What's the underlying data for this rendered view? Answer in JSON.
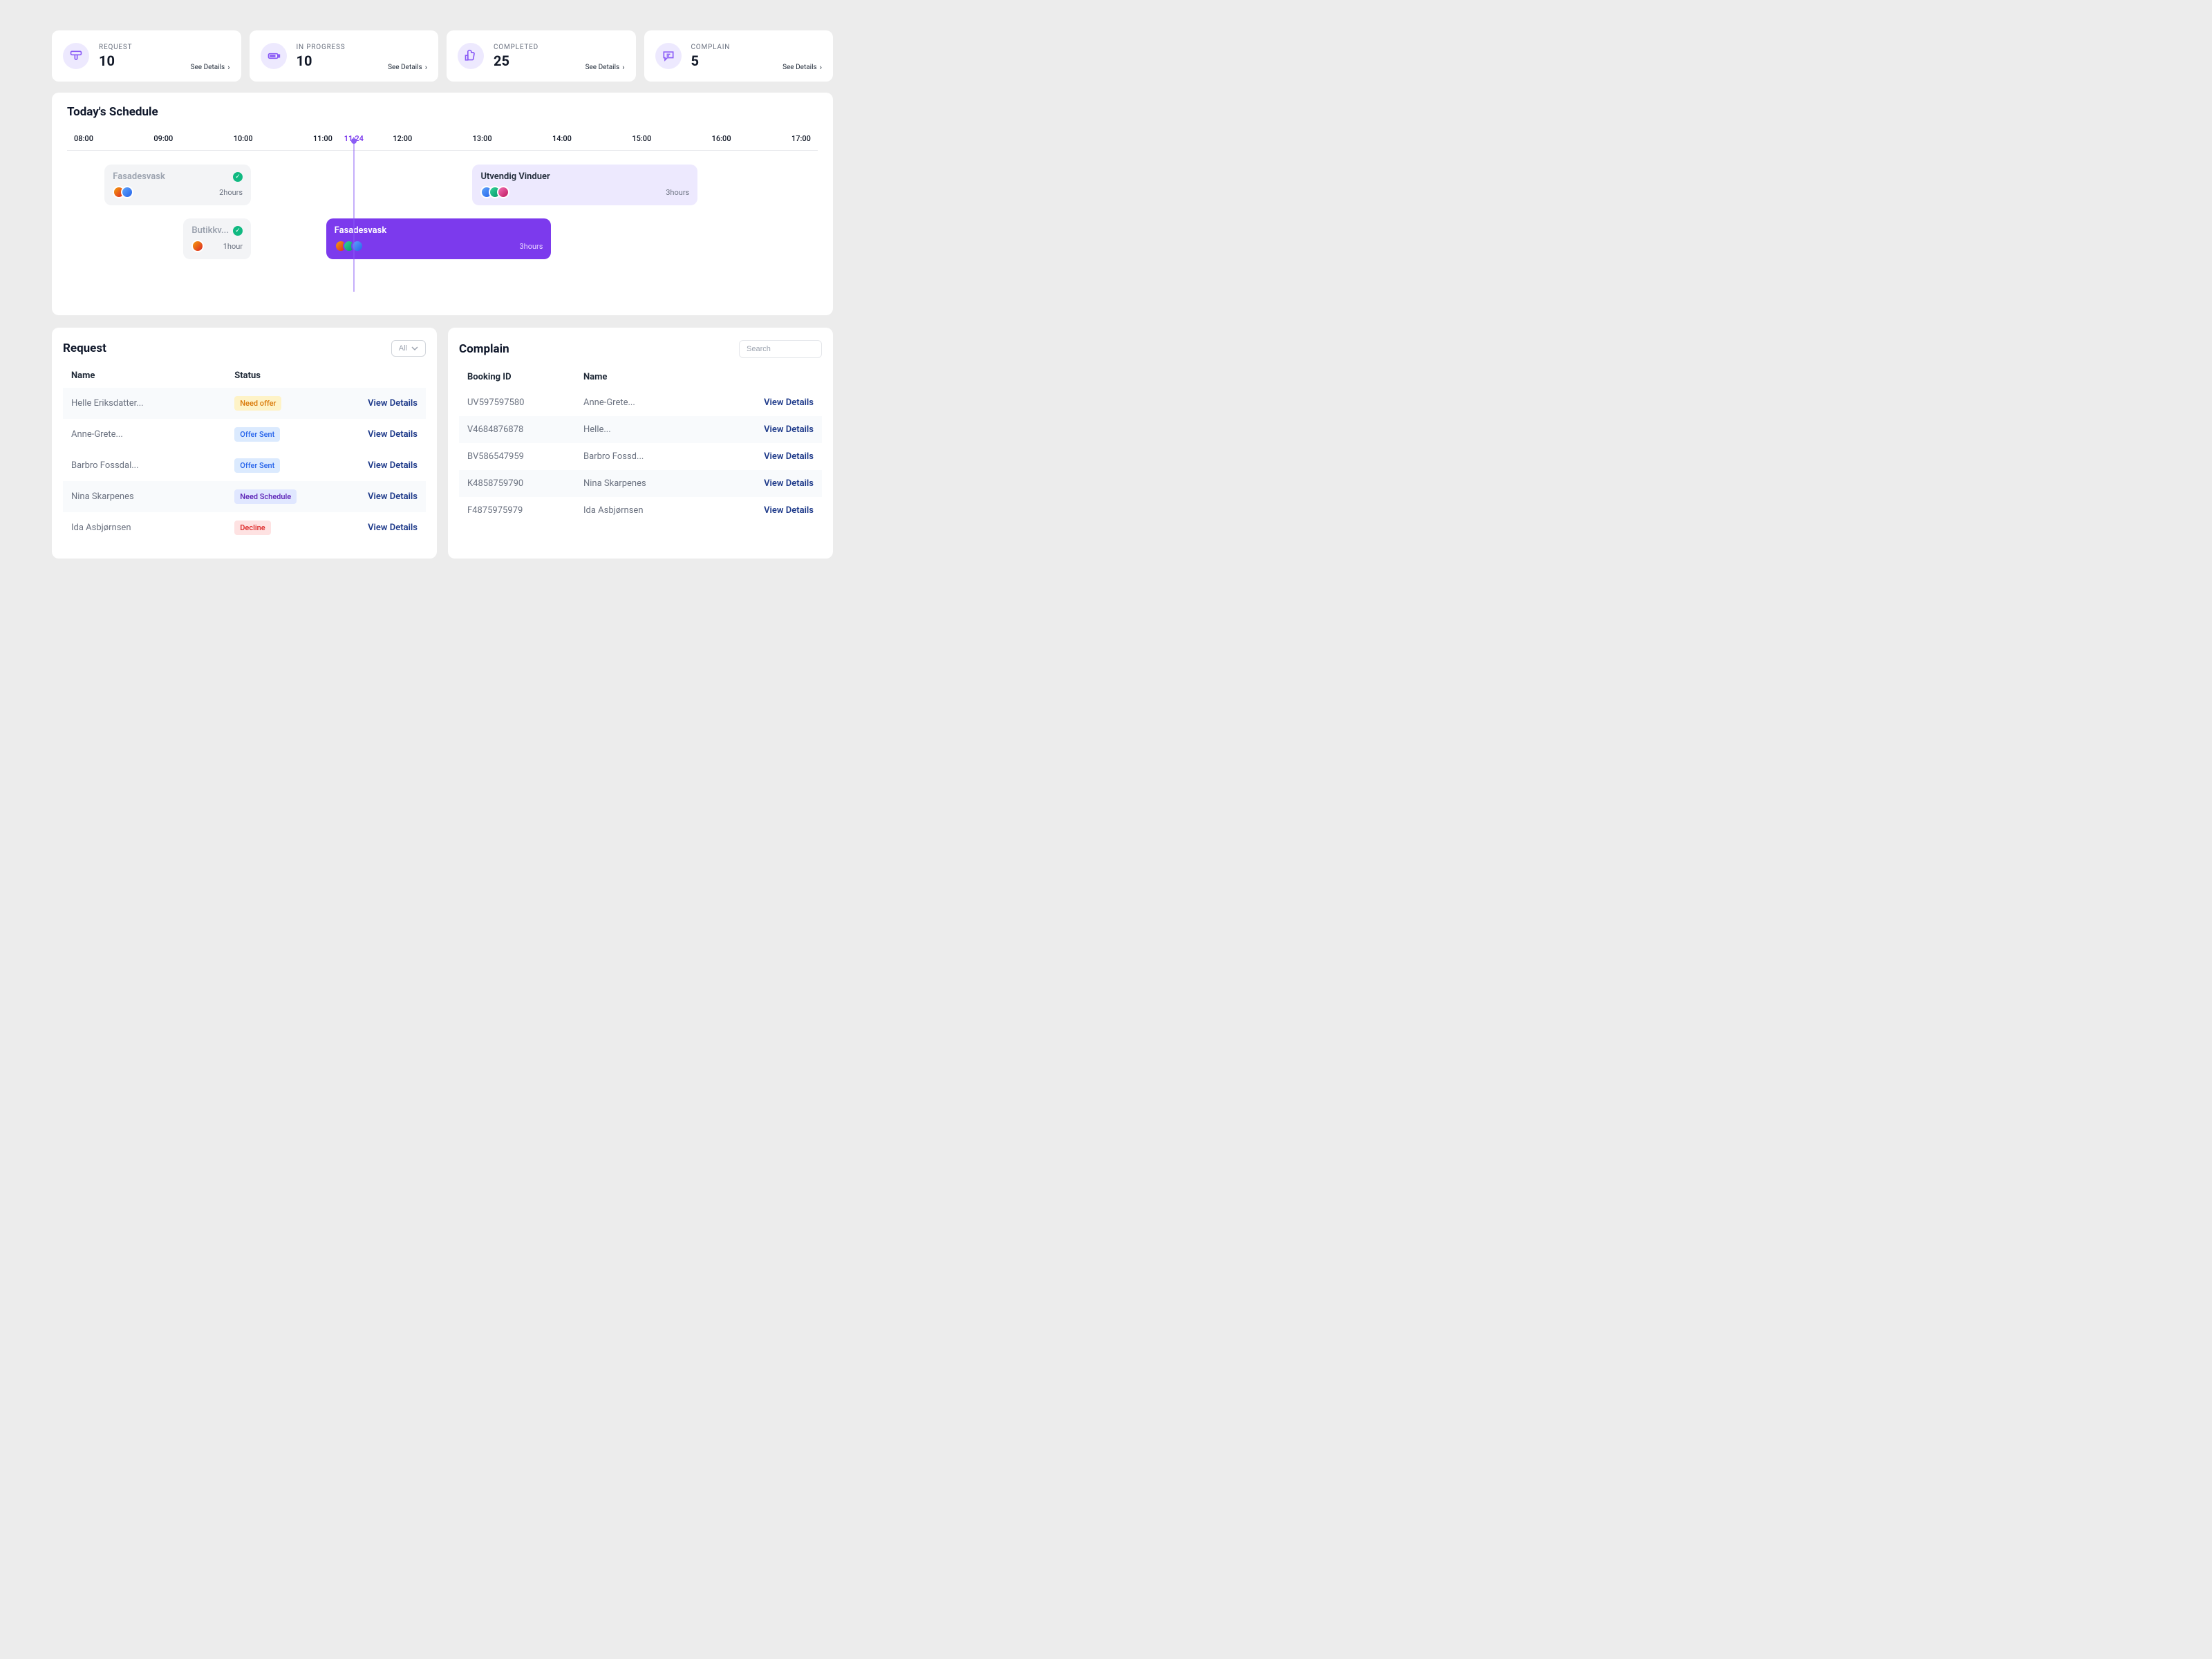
{
  "cards": [
    {
      "label": "REQUEST",
      "value": "10",
      "details": "See Details"
    },
    {
      "label": "IN PROGRESS",
      "value": "10",
      "details": "See Details"
    },
    {
      "label": "COMPLETED",
      "value": "25",
      "details": "See Details"
    },
    {
      "label": "COMPLAIN",
      "value": "5",
      "details": "See Details"
    }
  ],
  "schedule": {
    "title": "Today's Schedule",
    "hours": [
      "08:00",
      "09:00",
      "10:00",
      "11:00",
      "12:00",
      "13:00",
      "14:00",
      "15:00",
      "16:00",
      "17:00"
    ],
    "current_time": "11:24",
    "events": [
      {
        "title": "Fasadesvask",
        "duration": "2hours",
        "checked": true
      },
      {
        "title": "Butikkv...",
        "duration": "1hour",
        "checked": true
      },
      {
        "title": "Utvendig Vinduer",
        "duration": "3hours",
        "checked": false
      },
      {
        "title": "Fasadesvask",
        "duration": "3hours",
        "checked": false
      }
    ]
  },
  "request": {
    "title": "Request",
    "filter_label": "All",
    "columns": {
      "name": "Name",
      "status": "Status"
    },
    "view_label": "View Details",
    "rows": [
      {
        "name": "Helle Eriksdatter...",
        "status": "Need offer",
        "status_class": "need-offer",
        "zebra": true
      },
      {
        "name": "Anne-Grete...",
        "status": "Offer Sent",
        "status_class": "offer-sent",
        "zebra": false
      },
      {
        "name": "Barbro Fossdal...",
        "status": "Offer Sent",
        "status_class": "offer-sent",
        "zebra": false
      },
      {
        "name": "Nina Skarpenes",
        "status": "Need Schedule",
        "status_class": "need-schedule",
        "zebra": true
      },
      {
        "name": "Ida Asbjørnsen",
        "status": "Decline",
        "status_class": "decline",
        "zebra": false
      }
    ]
  },
  "complain": {
    "title": "Complain",
    "search_placeholder": "Search",
    "columns": {
      "booking": "Booking ID",
      "name": "Name"
    },
    "view_label": "View Details",
    "rows": [
      {
        "booking": "UV597597580",
        "name": "Anne-Grete...",
        "zebra": false
      },
      {
        "booking": "V4684876878",
        "name": "Helle...",
        "zebra": true
      },
      {
        "booking": "BV586547959",
        "name": "Barbro Fossd...",
        "zebra": false
      },
      {
        "booking": "K4858759790",
        "name": "Nina Skarpenes",
        "zebra": true
      },
      {
        "booking": "F4875975979",
        "name": "Ida Asbjørnsen",
        "zebra": false
      }
    ]
  }
}
